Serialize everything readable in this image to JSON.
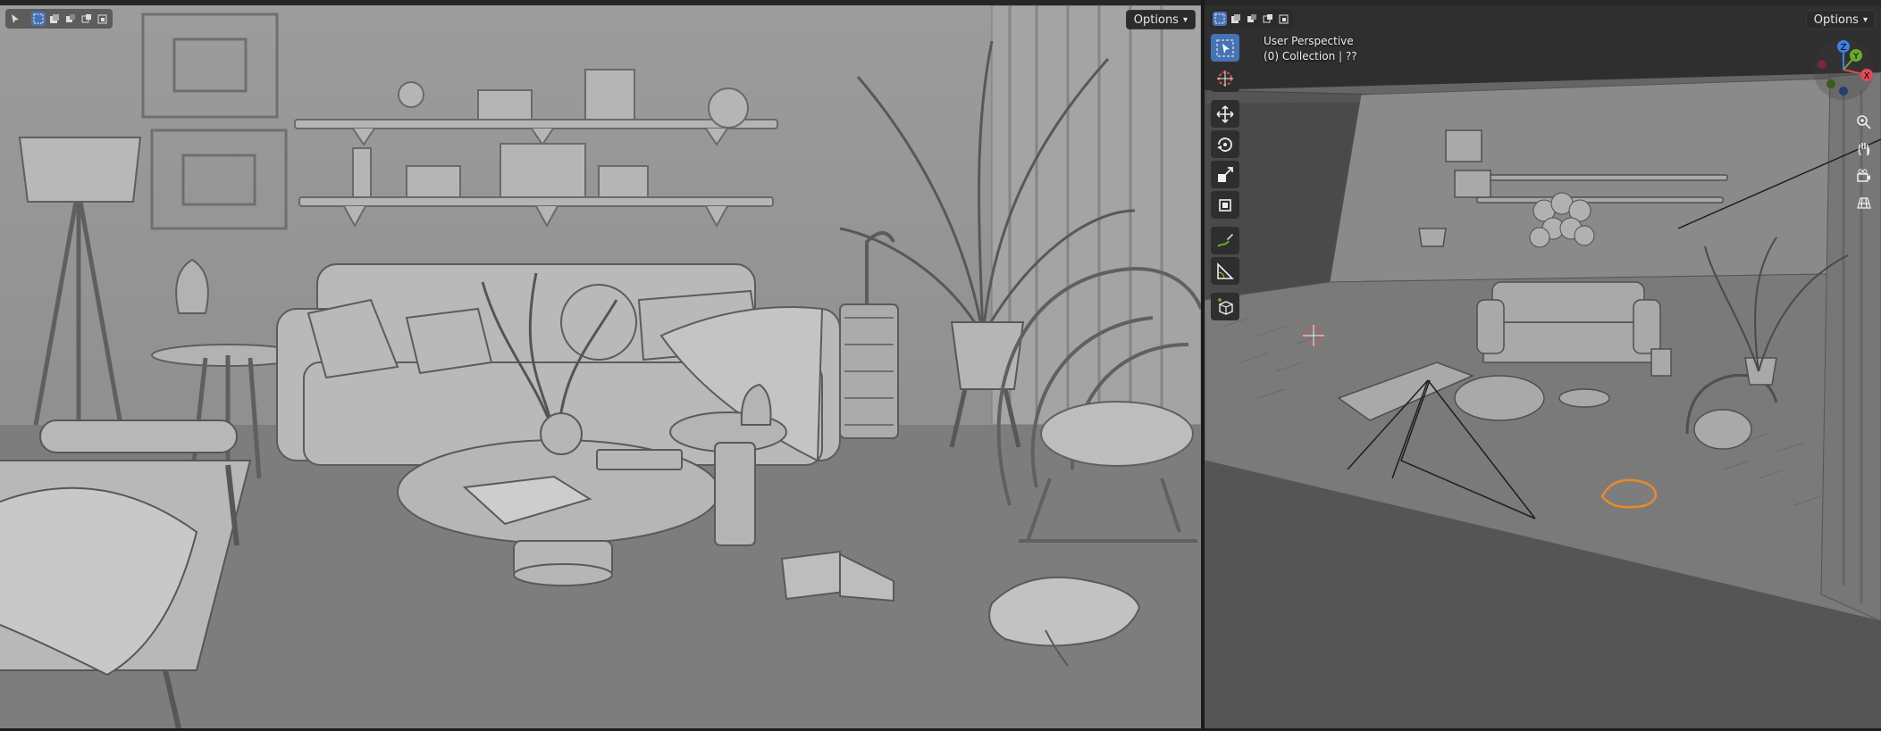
{
  "left_viewport": {
    "options_label": "Options",
    "select_modes": [
      "select-box-icon",
      "select-new-icon",
      "select-extend-icon",
      "select-subtract-icon",
      "select-intersect-icon"
    ]
  },
  "right_viewport": {
    "options_label": "Options",
    "view_name": "User Perspective",
    "collection_label": "(0) Collection | ??",
    "tools": [
      "select-box-icon",
      "cursor-icon",
      "move-icon",
      "rotate-icon",
      "scale-icon",
      "transform-icon",
      "annotate-icon",
      "measure-icon",
      "add-cube-icon"
    ],
    "gizmo_axes": {
      "z": "Z",
      "y": "Y",
      "x": "X"
    },
    "nav_buttons": [
      "zoom-icon",
      "hand-pan-icon",
      "camera-view-icon",
      "grid-view-icon"
    ]
  },
  "colors": {
    "accent_blue": "#4772b3",
    "selection_orange": "#e8892a",
    "axis_x": "#e04a5c",
    "axis_y": "#6aaa30",
    "axis_z": "#3f7fe0"
  }
}
